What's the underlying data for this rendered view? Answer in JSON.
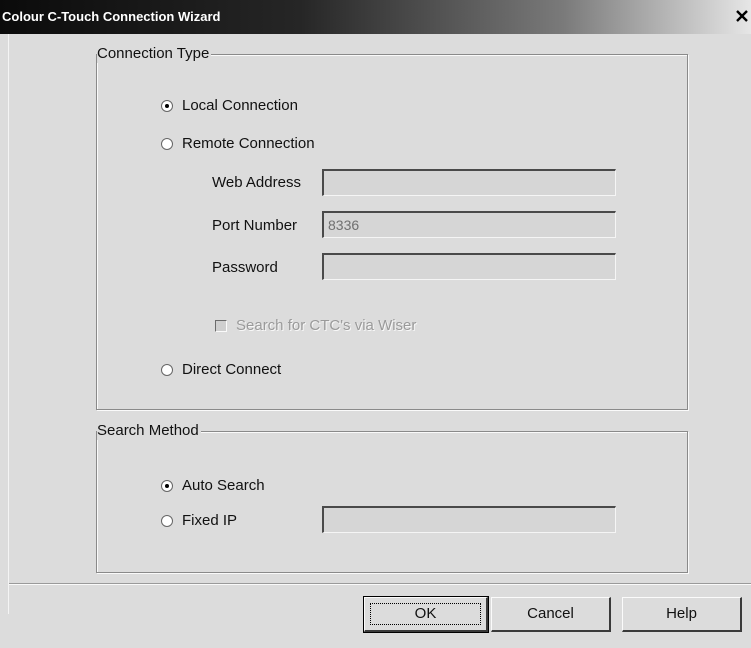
{
  "window": {
    "title": "Colour C-Touch Connection Wizard",
    "close_glyph": "✕"
  },
  "connection_type": {
    "legend": "Connection Type",
    "options": [
      {
        "label": "Local Connection",
        "selected": true
      },
      {
        "label": "Remote Connection",
        "selected": false
      },
      {
        "label": "Direct Connect",
        "selected": false
      }
    ],
    "web_address": {
      "label": "Web Address",
      "value": ""
    },
    "port_number": {
      "label": "Port Number",
      "value": "8336"
    },
    "password": {
      "label": "Password",
      "value": ""
    },
    "search_ctc": {
      "label": "Search for CTC's via Wiser",
      "checked": false,
      "enabled": false
    }
  },
  "search_method": {
    "legend": "Search Method",
    "options": [
      {
        "label": "Auto Search",
        "selected": true
      },
      {
        "label": "Fixed IP",
        "selected": false
      }
    ],
    "fixed_ip": {
      "value": ""
    }
  },
  "buttons": {
    "ok": "OK",
    "cancel": "Cancel",
    "help": "Help"
  },
  "colors": {
    "dialog_background": "#dcdcdc",
    "titlebar_start": "#0b0b0b",
    "titlebar_end": "#e6e6e6"
  },
  "icons": {
    "close": "close-icon"
  }
}
